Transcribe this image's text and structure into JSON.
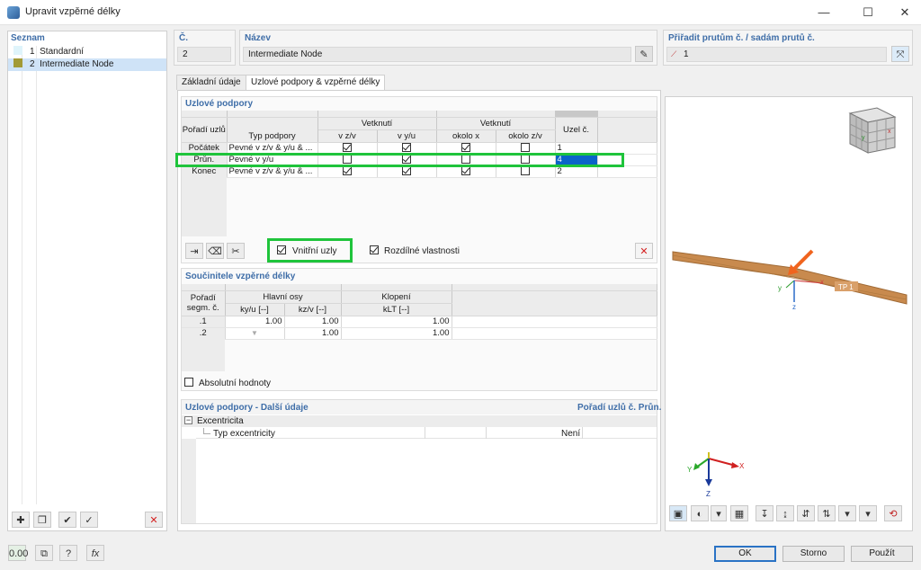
{
  "window": {
    "title": "Upravit vzpěrné délky",
    "minimize": "—",
    "maximize": "☐",
    "close": "✕"
  },
  "list": {
    "header": "Seznam",
    "items": [
      {
        "num": "1",
        "label": "Standardní",
        "color": "#dff4fb"
      },
      {
        "num": "2",
        "label": "Intermediate Node",
        "color": "#a29a36"
      }
    ]
  },
  "number": {
    "label": "Č.",
    "value": "2"
  },
  "name": {
    "label": "Název",
    "value": "Intermediate Node"
  },
  "assign": {
    "label": "Přiřadit prutům č. / sadám prutů č.",
    "value": "1"
  },
  "tabs": [
    "Základní údaje",
    "Uzlové podpory & vzpěrné délky"
  ],
  "nodal_supports": {
    "title": "Uzlové podpory",
    "headers": {
      "order": "Pořadí uzlů",
      "type": "Typ podpory",
      "fix_group": "Vetknutí",
      "vz": "v z/v",
      "vy": "v y/u",
      "rot_group": "Vetknutí",
      "ox": "okolo x",
      "oz": "okolo z/v",
      "node": "Uzel č."
    },
    "rows": [
      {
        "order": "Počátek",
        "type": "Pevné v z/v & y/u & ...",
        "node": "1"
      },
      {
        "order": "Průn.",
        "type": "Pevné v y/u",
        "node": "4"
      },
      {
        "order": "Konec",
        "type": "Pevné v z/v & y/u & ...",
        "node": "2"
      }
    ],
    "inner_nodes_label": "Vnitřní uzly",
    "diff_props_label": "Rozdílné vlastnosti"
  },
  "buckling": {
    "title": "Součinitele vzpěrné délky",
    "headers": {
      "order": "Pořadí segm. č.",
      "main_axes": "Hlavní osy",
      "ky": "ky/u [--]",
      "kz": "kz/v [--]",
      "lt_group": "Klopení",
      "klt": "kLT [--]"
    },
    "rows": [
      {
        "seg": ".1",
        "ky": "1.00",
        "kz": "1.00",
        "klt": "1.00"
      },
      {
        "seg": ".2",
        "ky": "",
        "kz": "1.00",
        "klt": "1.00"
      }
    ],
    "absolute_label": "Absolutní hodnoty"
  },
  "more": {
    "title": "Uzlové podpory - Další údaje",
    "right_title": "Pořadí uzlů č. Průn.",
    "group": "Excentricita",
    "row_label": "Typ excentricity",
    "row_value": "Není"
  },
  "viewport": {
    "member_label": "TP 1",
    "axis_x": "x",
    "axis_y": "y",
    "axis_z": "z",
    "gx": "X",
    "gy": "Y",
    "gz": "Z"
  },
  "buttons": {
    "ok": "OK",
    "cancel": "Storno",
    "apply": "Použít",
    "units": "0.00"
  },
  "colors": {
    "accent": "#3f6ea8",
    "selection": "#0a64c8",
    "highlight": "#1fc43b",
    "member": "#c88a4e",
    "marker": "#f0641e"
  }
}
